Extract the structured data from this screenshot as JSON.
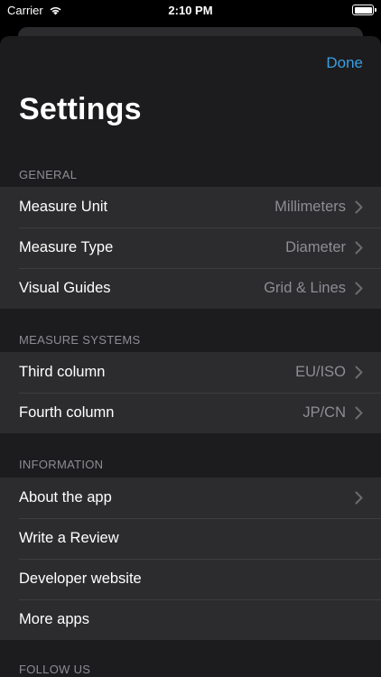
{
  "status_bar": {
    "carrier": "Carrier",
    "time": "2:10 PM"
  },
  "header": {
    "done_label": "Done",
    "title": "Settings"
  },
  "sections": [
    {
      "header": "GENERAL",
      "rows": [
        {
          "label": "Measure Unit",
          "value": "Millimeters",
          "chevron": true
        },
        {
          "label": "Measure Type",
          "value": "Diameter",
          "chevron": true
        },
        {
          "label": "Visual Guides",
          "value": "Grid & Lines",
          "chevron": true
        }
      ]
    },
    {
      "header": "MEASURE SYSTEMS",
      "rows": [
        {
          "label": "Third column",
          "value": "EU/ISO",
          "chevron": true
        },
        {
          "label": "Fourth column",
          "value": "JP/CN",
          "chevron": true
        }
      ]
    },
    {
      "header": "INFORMATION",
      "rows": [
        {
          "label": "About the app",
          "value": "",
          "chevron": true
        },
        {
          "label": "Write a Review",
          "value": "",
          "chevron": false
        },
        {
          "label": "Developer website",
          "value": "",
          "chevron": false
        },
        {
          "label": "More apps",
          "value": "",
          "chevron": false
        }
      ]
    },
    {
      "header": "FOLLOW US",
      "rows": []
    }
  ],
  "colors": {
    "accent": "#3a9fe0",
    "sheet_background": "#1c1c1e",
    "row_background": "#2c2c2e",
    "secondary_text": "#8d8d93"
  }
}
